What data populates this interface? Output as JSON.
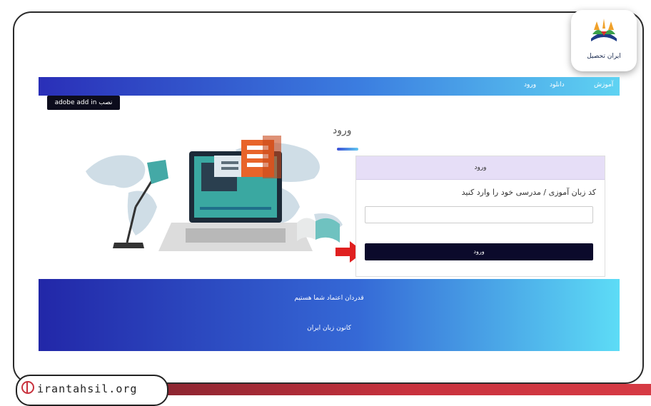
{
  "brand": {
    "logo_text": "ایران تحصیل",
    "site_url": "irantahsil.org"
  },
  "nav": {
    "items": [
      "آموزش",
      "دانلود",
      "ورود"
    ]
  },
  "install_button": "adobe add in نصب",
  "page": {
    "title": "ورود"
  },
  "login_card": {
    "header": "ورود",
    "field_label": "کد زبان آموزی / مدرسی خود را وارد کنید",
    "field_value": "",
    "submit_label": "ورود"
  },
  "footer": {
    "line1": "قدردان اعتماد شما هستیم",
    "line2": "کانون زبان ایران"
  },
  "colors": {
    "nav_gradient": [
      "#2a2fb8",
      "#5fd3f2"
    ],
    "button_dark": "#0b0a2b",
    "accent_red": "#c8313d",
    "card_header": "#e6def7"
  },
  "icons": [
    "globe-icon",
    "red-arrow-icon",
    "book-icon",
    "lamp-icon",
    "laptop-icon"
  ]
}
